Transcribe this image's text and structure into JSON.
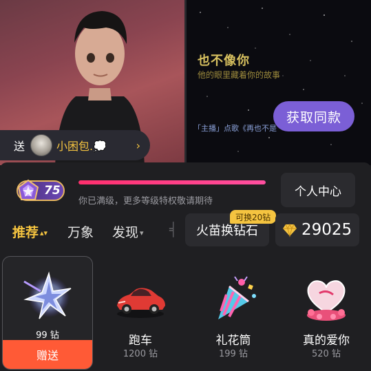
{
  "stream": {
    "lyric_title": "也不像你",
    "lyric_subtitle": "他的眼里藏着你的故事",
    "lyric_caption": "「主播」点歌《再也不是",
    "get_same_label": "获取同款"
  },
  "sender": {
    "prefix": "送",
    "name": "小困包.💭",
    "chevron": "›"
  },
  "level": {
    "value": "75",
    "progress": 1.0,
    "tip": "你已满级，更多等级特权敬请期待"
  },
  "profile_center_label": "个人中心",
  "tabs": [
    {
      "label": "推荐",
      "arrow": "▴▾"
    },
    {
      "label": "万象",
      "arrow": ""
    },
    {
      "label": "发现",
      "arrow": "▾"
    }
  ],
  "exchange": {
    "label": "火苗换钻石",
    "tag": "可换20钻"
  },
  "diamonds": {
    "count": "29025"
  },
  "gifts": [
    {
      "name": "",
      "price": "99 钻",
      "icon": "star-shard-icon",
      "selected": true,
      "send_label": "赠送"
    },
    {
      "name": "跑车",
      "price": "1200 钻",
      "icon": "sports-car-icon"
    },
    {
      "name": "礼花筒",
      "price": "199 钻",
      "icon": "party-popper-icon"
    },
    {
      "name": "真的爱你",
      "price": "520 钻",
      "icon": "heart-cake-icon"
    }
  ],
  "colors": {
    "accent_gold": "#f5c440",
    "send_orange": "#ff5a36",
    "purple_button": "#7b5fd6",
    "progress_pink": "#ff2f6d"
  }
}
